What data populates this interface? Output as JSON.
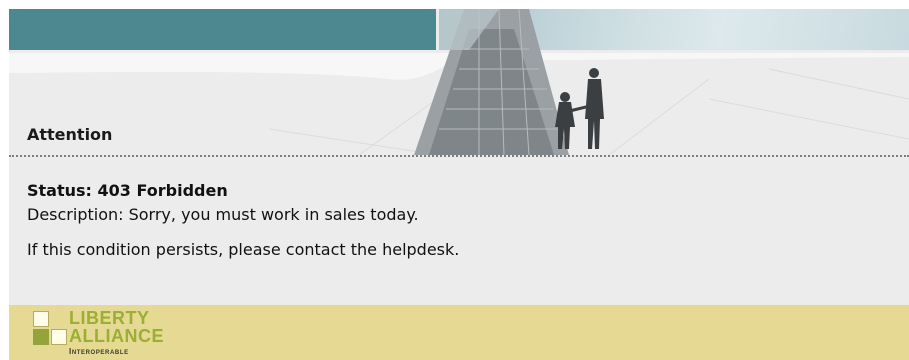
{
  "header": {
    "title": "Attention"
  },
  "message": {
    "status": "Status: 403 Forbidden",
    "description": "Description: Sorry, you must work in sales today.",
    "persist_note": "If this condition persists, please contact the helpdesk."
  },
  "footer": {
    "logo": {
      "line1": "LIBERTY",
      "line2": "ALLIANCE",
      "line3": "Interoperable"
    }
  },
  "colors": {
    "banner_teal": "#4d8790",
    "page_background": "#ececec",
    "footer_background": "#e5d993",
    "logo_green": "#9aaf33"
  },
  "icons": [
    "liberty-alliance-logo"
  ]
}
